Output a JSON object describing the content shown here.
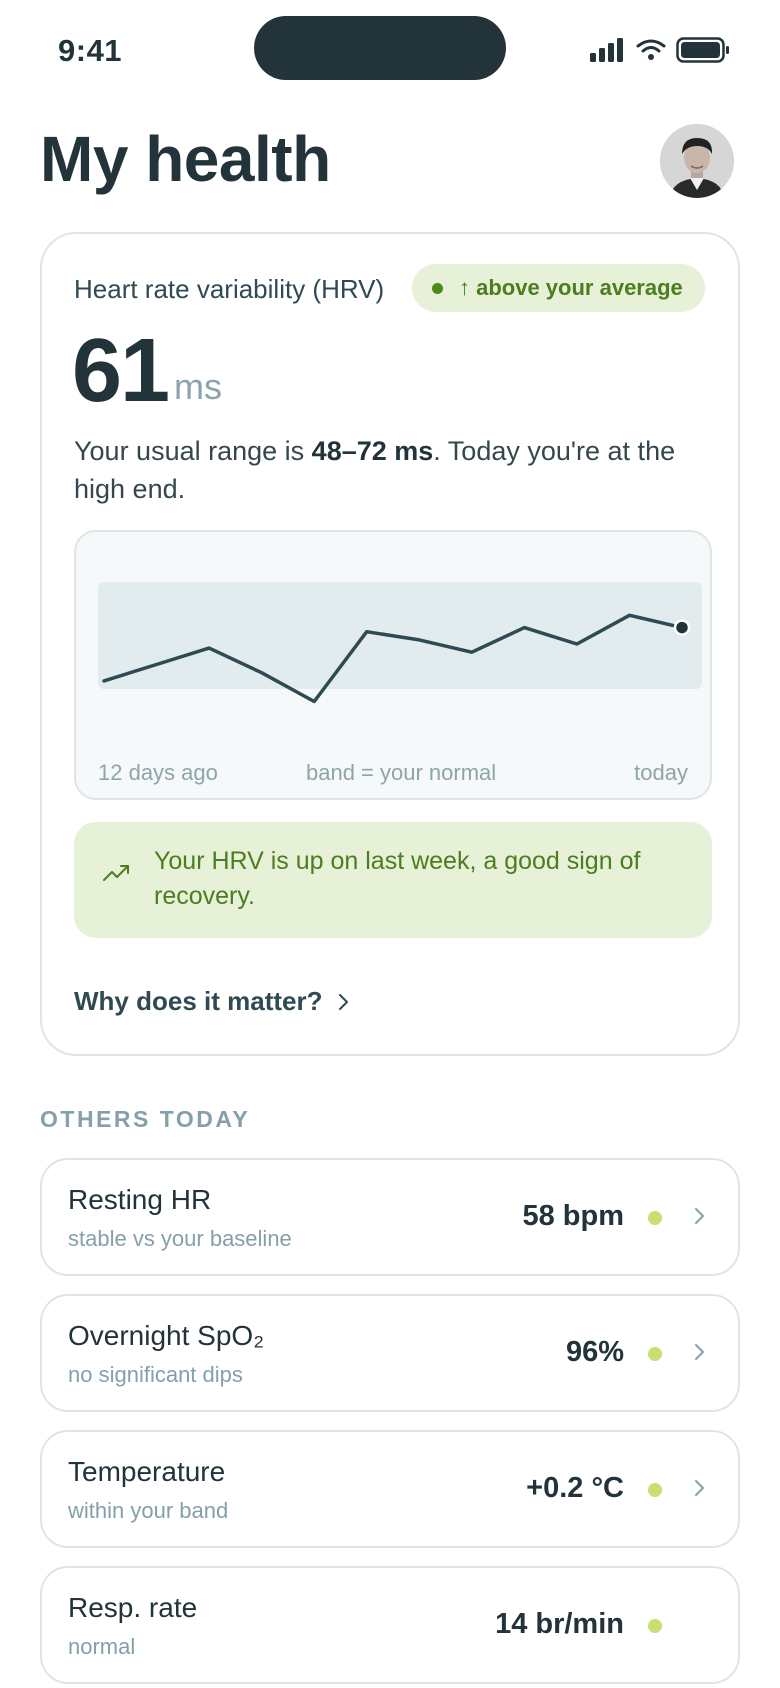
{
  "status_bar": {
    "time": "9:41"
  },
  "header": {
    "title": "My health"
  },
  "hrv": {
    "label": "Heart rate variability (HRV)",
    "badge": "↑ above your average",
    "value": "61",
    "unit": "ms",
    "range_prefix": "Your usual range is ",
    "range_value": "48–72 ms",
    "range_suffix": ". Today you're at the high end.",
    "chart": {
      "label_start": "12 days ago",
      "label_middle": "band = your normal",
      "label_end": "today"
    },
    "insight": "Your HRV is up on last week, a good sign of recovery.",
    "learn_more": "Why does it matter?"
  },
  "chart_data": {
    "type": "line",
    "x": [
      "12 days ago",
      "",
      "",
      "",
      "",
      "",
      "",
      "",
      "",
      "",
      "",
      "",
      "today"
    ],
    "series": [
      {
        "values": [
          48,
          52,
          56,
          50,
          43,
          60,
          58,
          55,
          61,
          57,
          64,
          61
        ]
      }
    ],
    "band": [
      48,
      72
    ],
    "ylim": [
      38,
      76
    ],
    "annotations": [
      "band = your normal"
    ]
  },
  "others": {
    "section_title": "OTHERS TODAY",
    "items": [
      {
        "name": "Resting HR",
        "subtitle": "stable vs your baseline",
        "value": "58 bpm",
        "status_color": "#c6df6e",
        "has_chevron": true
      },
      {
        "name": "Overnight SpO₂",
        "subtitle": "no significant dips",
        "value": "96%",
        "status_color": "#c6df6e",
        "has_chevron": true
      },
      {
        "name": "Temperature",
        "subtitle": "within your band",
        "value": "+0.2 °C",
        "status_color": "#c6df6e",
        "has_chevron": true
      },
      {
        "name": "Resp. rate",
        "subtitle": "normal",
        "value": "14 br/min",
        "status_color": "#c6df6e",
        "has_chevron": false
      }
    ]
  },
  "colors": {
    "ink": "#22333a",
    "accent_green": "#4c7d1e",
    "status_good": "#c6df6e",
    "band": "#e2ecee"
  },
  "icons": [
    "signal-icon",
    "wifi-icon",
    "battery-icon",
    "trend-up-icon",
    "chevron-right-icon"
  ]
}
